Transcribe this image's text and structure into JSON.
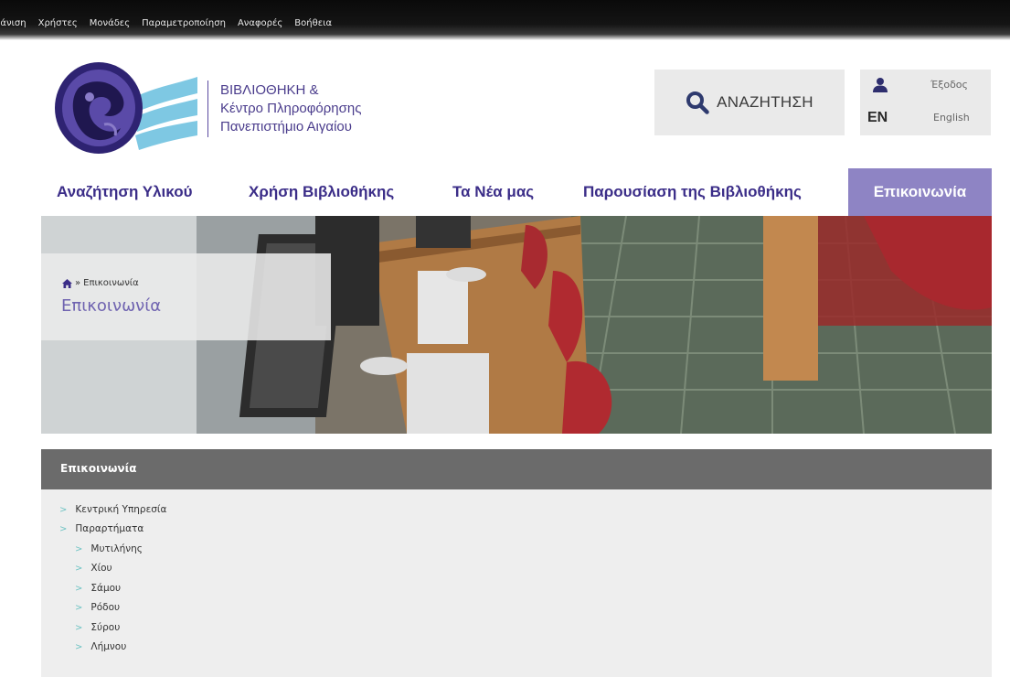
{
  "admin_bar": {
    "items": [
      "ράνιση",
      "Χρήστες",
      "Μονάδες",
      "Παραμετροποίηση",
      "Αναφορές",
      "Βοήθεια"
    ]
  },
  "brand": {
    "line1": "ΒΙΒΛΙΟΘΗΚΗ &",
    "line2": "Κέντρο Πληροφόρησης",
    "line3": "Πανεπιστήμιο Αιγαίου"
  },
  "search": {
    "label": "ΑΝΑΖΗΤΗΣΗ",
    "icon": "search-icon"
  },
  "user": {
    "logout_label": "Έξοδος",
    "lang_code": "EN",
    "lang_label": "English",
    "icon": "user-icon"
  },
  "nav": {
    "items": [
      "Αναζήτηση Υλικού",
      "Χρήση Βιβλιοθήκης",
      "Τα Νέα μας",
      "Παρουσίαση της Βιβλιοθήκης",
      "Επικοινωνία"
    ],
    "active": "Επικοινωνία"
  },
  "breadcrumb": {
    "separator": "»",
    "current": "Επικοινωνία",
    "icon": "home-icon"
  },
  "page_title": "Επικοινωνία",
  "panel": {
    "title": "Επικοινωνία",
    "items": [
      {
        "label": "Κεντρική Υπηρεσία",
        "level": 1
      },
      {
        "label": "Παραρτήματα",
        "level": 1
      },
      {
        "label": "Μυτιλήνης",
        "level": 2
      },
      {
        "label": "Χίου",
        "level": 2
      },
      {
        "label": "Σάμου",
        "level": 2
      },
      {
        "label": "Ρόδου",
        "level": 2
      },
      {
        "label": "Σύρου",
        "level": 2
      },
      {
        "label": "Λήμνου",
        "level": 2
      }
    ]
  },
  "colors": {
    "brand_purple": "#3b2d88",
    "nav_active_bg": "#8e84c4",
    "title_purple": "#6f63b0",
    "panel_header": "#6b6b6b",
    "panel_bg": "#eeeeee",
    "chevron": "#6ec3c3"
  }
}
